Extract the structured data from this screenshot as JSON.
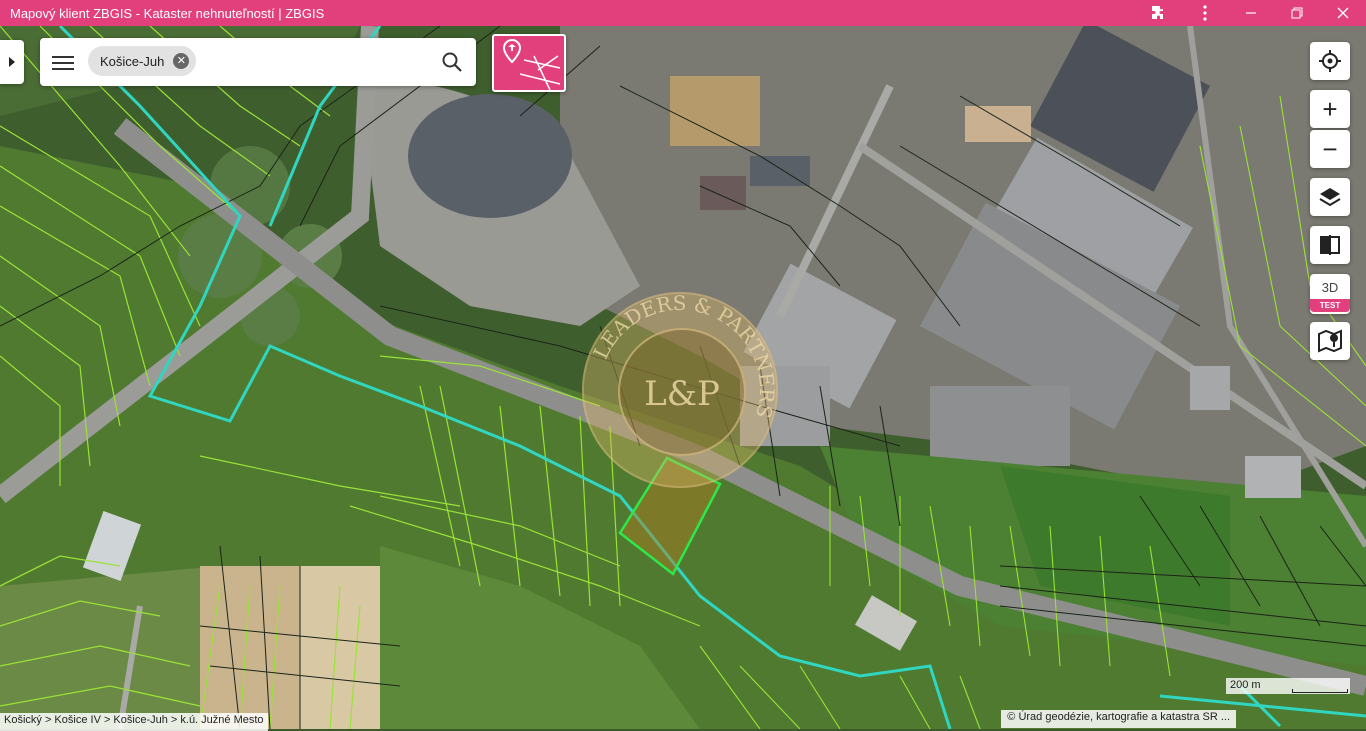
{
  "window": {
    "title": "Mapový klient ZBGIS - Kataster nehnuteľností | ZBGIS",
    "extension_icon": "puzzle-icon",
    "more_icon": "kebab-menu-icon",
    "minimize_icon": "minimize-icon",
    "restore_icon": "restore-icon",
    "close_icon": "close-icon"
  },
  "search": {
    "chip_label": "Košice-Juh",
    "clear_icon": "clear-icon",
    "menu_icon": "hamburger-menu-icon",
    "search_icon": "search-icon"
  },
  "poi_button": {
    "icon": "parcel-marker-icon"
  },
  "tools": {
    "locate_icon": "crosshair-icon",
    "zoom_in_label": "+",
    "zoom_out_label": "−",
    "layers_icon": "layers-icon",
    "compare_icon": "compare-icon",
    "label_3d": "3D",
    "badge_3d": "TEST",
    "gmap_icon": "google-maps-icon"
  },
  "scale": {
    "label": "200 m"
  },
  "breadcrumb": "Košický > Košice IV > Košice-Juh > k.ú. Južné Mesto",
  "attribution": "© Úrad geodézie, kartografie a katastra SR ...",
  "watermark": {
    "ring_text": "LEADERS & PARTNERS",
    "monogram": "L&P"
  },
  "colors": {
    "accent": "#e2407c",
    "parcel_lines": "#9be236",
    "cadastral_boundary": "#30d6c0",
    "selected_parcel": "#2ee84a"
  }
}
